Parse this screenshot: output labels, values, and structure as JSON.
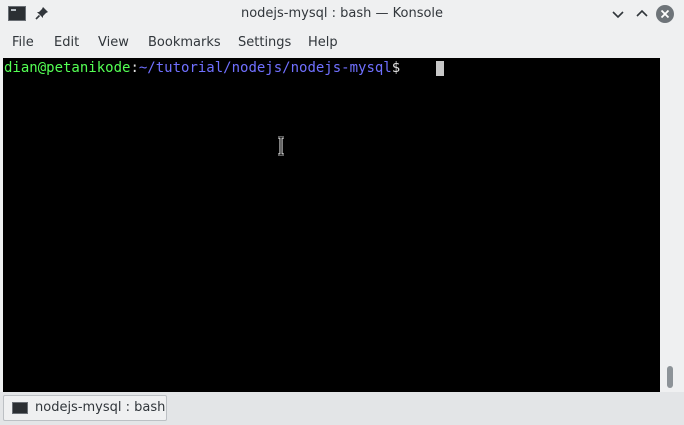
{
  "window": {
    "title": "nodejs-mysql : bash — Konsole"
  },
  "menubar": {
    "items": [
      "File",
      "Edit",
      "View",
      "Bookmarks",
      "Settings",
      "Help"
    ]
  },
  "terminal": {
    "prompt_user_host": "dian@petanikode",
    "prompt_colon": ":",
    "prompt_path": "~/tutorial/nodejs/nodejs-mysql",
    "prompt_symbol": "$",
    "colors": {
      "background": "#000000",
      "user_host": "#54ff54",
      "path": "#7070ff"
    }
  },
  "tabs": [
    {
      "label": "nodejs-mysql : bash"
    }
  ],
  "icons": {
    "app": "konsole-terminal-icon",
    "pin": "pin-icon",
    "minimize": "chevron-down-icon",
    "maximize": "chevron-up-icon",
    "close": "close-icon",
    "tab": "terminal-icon",
    "mouse": "text-cursor-icon"
  }
}
